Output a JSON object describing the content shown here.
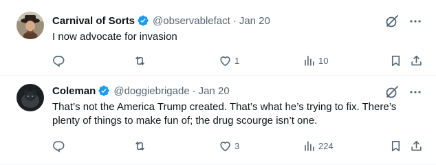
{
  "colors": {
    "accent": "#1d9bf0",
    "text": "#0f1419",
    "muted": "#536471",
    "divider": "#eff3f4"
  },
  "tweets": [
    {
      "name": "Carnival of Sorts",
      "handle": "@observablefact",
      "separator": "·",
      "date": "Jan 20",
      "text": "I now advocate for invasion",
      "replies": "",
      "retweets": "",
      "likes": "1",
      "views": "10",
      "verified": true
    },
    {
      "name": "Coleman",
      "handle": "@doggiebrigade",
      "separator": "·",
      "date": "Jan 20",
      "text": "That’s not the America Trump created. That’s what he’s trying to fix. There’s plenty of things to make fun of; the drug scourge isn’t one.",
      "replies": "",
      "retweets": "",
      "likes": "3",
      "views": "224",
      "verified": true
    }
  ],
  "icons": [
    "verified-badge-icon",
    "grok-icon",
    "more-icon",
    "reply-icon",
    "retweet-icon",
    "like-icon",
    "views-icon",
    "bookmark-icon",
    "share-icon"
  ]
}
